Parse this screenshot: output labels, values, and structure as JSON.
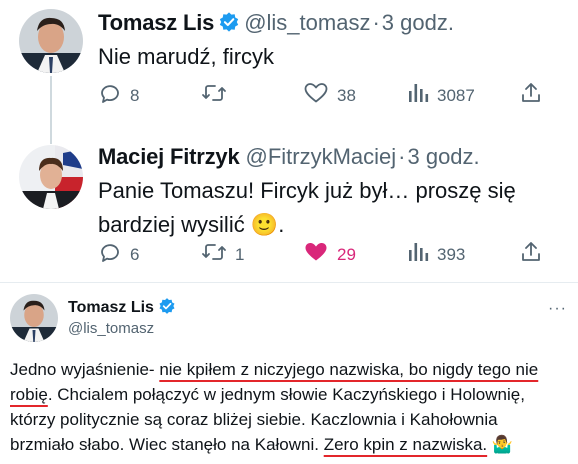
{
  "tweet1": {
    "author_name": "Tomasz Lis",
    "handle": "@lis_tomasz",
    "separator": "·",
    "time": "3 godz.",
    "text": "Nie marudź, fircyk",
    "replies": "8",
    "retweets": "",
    "likes": "38",
    "views": "3087"
  },
  "tweet2": {
    "author_name": "Maciej Fitrzyk",
    "handle": "@FitrzykMaciej",
    "separator": "·",
    "time": "3 godz.",
    "text_line1": "Panie Tomaszu! Fircyk już był… proszę się",
    "text_line2": "bardziej wysilić",
    "emoji": "🙂",
    "text_end": ".",
    "replies": "6",
    "retweets": "1",
    "likes": "29",
    "views": "393"
  },
  "tweet3": {
    "author_name": "Tomasz Lis",
    "handle": "@lis_tomasz",
    "more": "···",
    "t1": "Jedno wyjaśnienie- ",
    "t2": "nie kpiłem z niczyjego nazwiska, bo nigdy tego nie",
    "t3": "robię",
    "t4": ". Chcialem połączyć w jednym słowie Kaczyńskiego i Holownię,",
    "t5": "którzy politycznie są coraz bliżej siebie. Kaczlownia i Kahołownia",
    "t6": "brzmiało słabo. Wiec stanęło na Kałowni. ",
    "t7": "Zero kpin z nazwiska.",
    "t8": " 🤷‍♂️"
  },
  "colors": {
    "verified": "#1d9bf0",
    "like_active": "#d9277a",
    "underline_marker": "#e3262b",
    "muted_text": "#536471"
  },
  "icons": [
    "verified-badge-icon",
    "reply-icon",
    "retweet-icon",
    "like-icon",
    "views-icon",
    "share-icon",
    "more-icon"
  ]
}
